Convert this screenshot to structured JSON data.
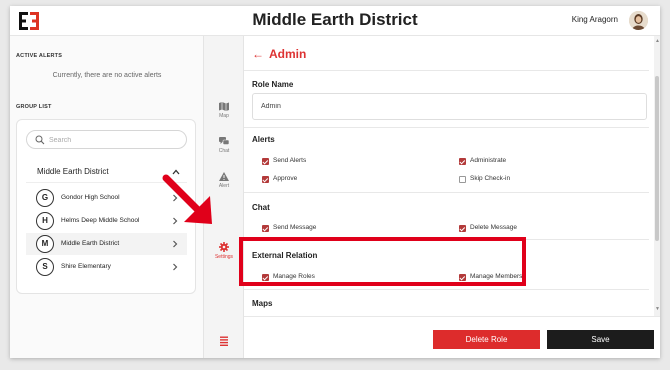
{
  "header": {
    "title": "Middle Earth District",
    "user_name": "King Aragorn"
  },
  "left_panel": {
    "active_alerts_label": "ACTIVE ALERTS",
    "active_alerts_empty": "Currently, there are no active alerts",
    "group_list_label": "GROUP LIST",
    "search_placeholder": "Search",
    "district": {
      "label": "Middle Earth District"
    },
    "schools": [
      {
        "initial": "G",
        "name": "Gondor High School"
      },
      {
        "initial": "H",
        "name": "Helms Deep Middle School"
      },
      {
        "initial": "M",
        "name": "Middle Earth District"
      },
      {
        "initial": "S",
        "name": "Shire Elementary"
      }
    ]
  },
  "rail": {
    "items": [
      {
        "label": "Map",
        "icon": "map-icon"
      },
      {
        "label": "Chat",
        "icon": "chat-icon"
      },
      {
        "label": "Alert",
        "icon": "alert-icon"
      },
      {
        "label": "Settings",
        "icon": "gear-icon"
      }
    ]
  },
  "main": {
    "back_title": "Admin",
    "role_name": {
      "label": "Role Name",
      "value": "Admin"
    },
    "alerts": {
      "title": "Alerts",
      "options": [
        {
          "label": "Send Alerts",
          "checked": true
        },
        {
          "label": "Administrate",
          "checked": true
        },
        {
          "label": "Approve",
          "checked": true
        },
        {
          "label": "Skip Check-in",
          "checked": false
        }
      ]
    },
    "chat": {
      "title": "Chat",
      "options": [
        {
          "label": "Send Message",
          "checked": true
        },
        {
          "label": "Delete Message",
          "checked": true
        }
      ]
    },
    "external_relation": {
      "title": "External Relation",
      "options": [
        {
          "label": "Manage Roles",
          "checked": true
        },
        {
          "label": "Manage Members",
          "checked": true
        }
      ]
    },
    "maps": {
      "title": "Maps"
    },
    "buttons": {
      "delete": "Delete Role",
      "save": "Save"
    }
  },
  "colors": {
    "accent": "#dd2c2c",
    "checkbox": "#b33a3a",
    "highlight": "#e0001a",
    "save_button": "#1c1c1c"
  }
}
